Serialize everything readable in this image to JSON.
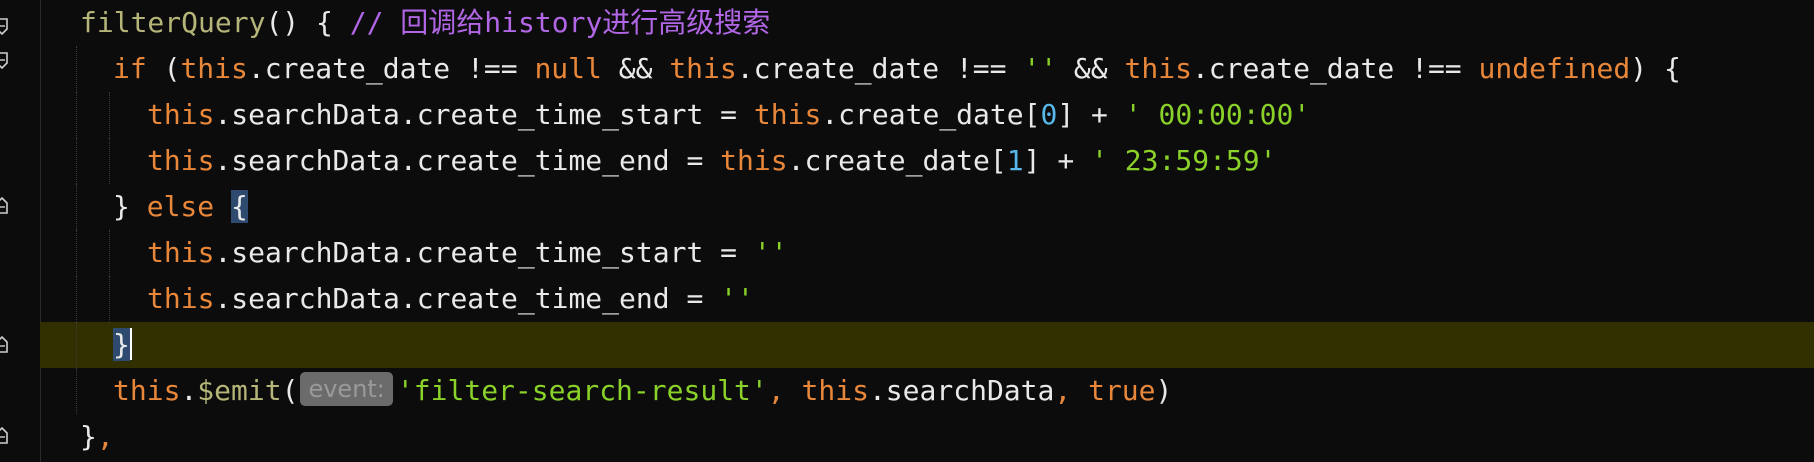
{
  "lines": [
    {
      "tokens": [
        {
          "t": "filterQuery",
          "c": "fn"
        },
        {
          "t": "() { ",
          "c": "plain"
        },
        {
          "t": "// 回调给history进行高级搜索",
          "c": "cmt"
        }
      ]
    },
    {
      "tokens": [
        {
          "t": "if",
          "c": "kw"
        },
        {
          "t": " (",
          "c": "plain"
        },
        {
          "t": "this",
          "c": "this"
        },
        {
          "t": ".create_date !== ",
          "c": "prop"
        },
        {
          "t": "null",
          "c": "kw"
        },
        {
          "t": " && ",
          "c": "plain"
        },
        {
          "t": "this",
          "c": "this"
        },
        {
          "t": ".create_date !== ",
          "c": "prop"
        },
        {
          "t": "''",
          "c": "str"
        },
        {
          "t": " && ",
          "c": "plain"
        },
        {
          "t": "this",
          "c": "this"
        },
        {
          "t": ".create_date !== ",
          "c": "prop"
        },
        {
          "t": "undefined",
          "c": "kw"
        },
        {
          "t": ") {",
          "c": "plain"
        }
      ]
    },
    {
      "tokens": [
        {
          "t": "this",
          "c": "this"
        },
        {
          "t": ".searchData.create_time_start = ",
          "c": "prop"
        },
        {
          "t": "this",
          "c": "this"
        },
        {
          "t": ".create_date[",
          "c": "prop"
        },
        {
          "t": "0",
          "c": "num"
        },
        {
          "t": "] + ",
          "c": "plain"
        },
        {
          "t": "' 00:00:00'",
          "c": "str"
        }
      ]
    },
    {
      "tokens": [
        {
          "t": "this",
          "c": "this"
        },
        {
          "t": ".searchData.create_time_end = ",
          "c": "prop"
        },
        {
          "t": "this",
          "c": "this"
        },
        {
          "t": ".create_date[",
          "c": "prop"
        },
        {
          "t": "1",
          "c": "num"
        },
        {
          "t": "] + ",
          "c": "plain"
        },
        {
          "t": "' 23:59:59'",
          "c": "str"
        }
      ]
    },
    {
      "tokens": [
        {
          "t": "} ",
          "c": "plain"
        },
        {
          "t": "else",
          "c": "kw"
        },
        {
          "t": " ",
          "c": "plain"
        },
        {
          "t": "{",
          "c": "brace-hl"
        }
      ]
    },
    {
      "tokens": [
        {
          "t": "this",
          "c": "this"
        },
        {
          "t": ".searchData.create_time_start = ",
          "c": "prop"
        },
        {
          "t": "''",
          "c": "str"
        }
      ]
    },
    {
      "tokens": [
        {
          "t": "this",
          "c": "this"
        },
        {
          "t": ".searchData.create_time_end = ",
          "c": "prop"
        },
        {
          "t": "''",
          "c": "str"
        }
      ]
    },
    {
      "tokens": [
        {
          "t": "}",
          "c": "brace-hl"
        }
      ],
      "cursor": true
    },
    {
      "tokens": [
        {
          "t": "this",
          "c": "this"
        },
        {
          "t": ".",
          "c": "plain"
        },
        {
          "t": "$emit",
          "c": "method"
        },
        {
          "t": "(",
          "c": "plain"
        },
        {
          "hint": "event:"
        },
        {
          "t": "'filter-search-result'",
          "c": "str"
        },
        {
          "t": ", ",
          "c": "kw"
        },
        {
          "t": "this",
          "c": "this"
        },
        {
          "t": ".searchData",
          "c": "prop"
        },
        {
          "t": ", ",
          "c": "kw"
        },
        {
          "t": "true",
          "c": "kw"
        },
        {
          "t": ")",
          "c": "plain"
        }
      ]
    },
    {
      "tokens": [
        {
          "t": "}",
          "c": "plain"
        },
        {
          "t": ",",
          "c": "kw"
        }
      ]
    }
  ],
  "gutter_icons": [
    "fold-open-icon",
    "fold-open-icon",
    "fold-close-icon",
    "fold-close-icon",
    "fold-close-icon"
  ]
}
